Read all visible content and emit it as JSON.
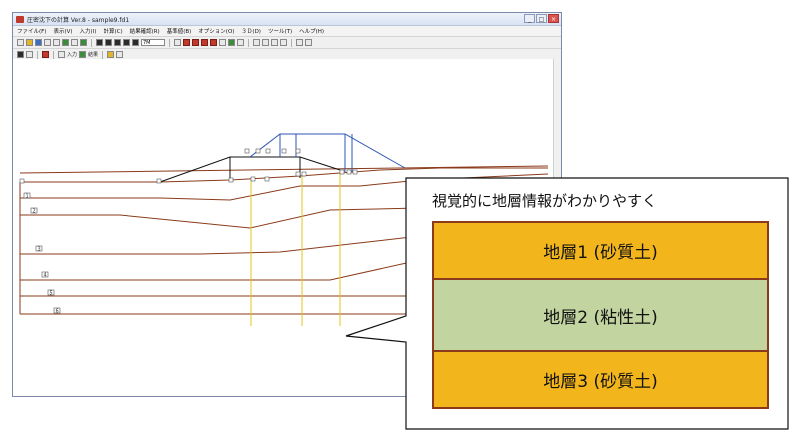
{
  "window": {
    "title": "圧密沈下の計算 Ver.8 - sample9.fd1",
    "buttons": {
      "minimize": "_",
      "maximize": "□",
      "close": "×"
    }
  },
  "menu": [
    "ファイル(F)",
    "表示(V)",
    "入力(I)",
    "計算(C)",
    "結果確認(R)",
    "基準値(B)",
    "オプション(O)",
    "３Ｄ(D)",
    "ツール(T)",
    "ヘルプ(H)"
  ],
  "toolbar": {
    "zoom_value": "7M",
    "label_input": "入力",
    "label_result": "結果"
  },
  "layer_tags": [
    "1",
    "2",
    "3",
    "4",
    "5",
    "6"
  ],
  "callout": {
    "title": "視覚的に地層情報がわかりやすく",
    "layers": [
      {
        "label": "地層1 (砂質土)",
        "color": "#f2b51c"
      },
      {
        "label": "地層2 (粘性土)",
        "color": "#c2d5a0"
      },
      {
        "label": "地層3 (砂質土)",
        "color": "#f2b51c"
      }
    ]
  },
  "colors": {
    "ground_line": "#8b3a1a",
    "embankment_line": "#2f55b8",
    "section_line": "#e6c619",
    "border": "#8b3a1a"
  }
}
